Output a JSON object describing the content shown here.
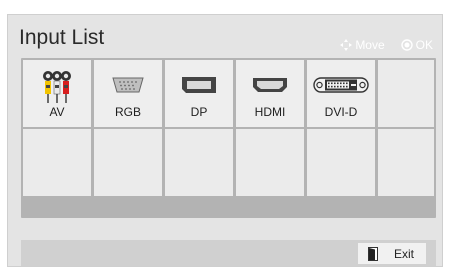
{
  "window": {
    "title": "Input List"
  },
  "hints": {
    "move_label": "Move",
    "ok_label": "OK"
  },
  "inputs": [
    {
      "label": "AV",
      "icon": "av-rca-icon"
    },
    {
      "label": "RGB",
      "icon": "vga-port-icon"
    },
    {
      "label": "DP",
      "icon": "displayport-icon"
    },
    {
      "label": "HDMI",
      "icon": "hdmi-port-icon"
    },
    {
      "label": "DVI-D",
      "icon": "dvi-port-icon"
    }
  ],
  "footer": {
    "exit_label": "Exit"
  },
  "colors": {
    "panel_bg": "#e4e4e4",
    "grid_bg": "#b3b3b3",
    "cell_bg": "#eeeeee",
    "footer_bg": "#d0d0d0"
  }
}
